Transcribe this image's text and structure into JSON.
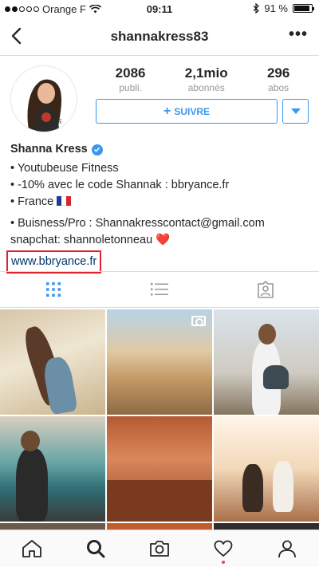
{
  "status_bar": {
    "carrier": "Orange F",
    "time": "09:11",
    "battery": "91 %",
    "battery_level": 0.91
  },
  "nav": {
    "username": "shannakress83"
  },
  "profile": {
    "stats": [
      {
        "value": "2086",
        "label": "publi."
      },
      {
        "value": "2,1mio",
        "label": "abonnés"
      },
      {
        "value": "296",
        "label": "abos"
      }
    ],
    "follow_label": "SUIVRE",
    "name": "Shanna Kress",
    "bio_lines": [
      "• Youtubeuse Fitness",
      "• -10% avec le code Shannak : bbryance.fr",
      "• France",
      "• Buisness/Pro : Shannakresscontact@gmail.com",
      "snapchat: shannoletonneau ❤️"
    ],
    "website": "www.bbryance.fr"
  },
  "icons": {
    "back": "chevron-left-icon",
    "more": "more-icon",
    "grid": "grid-view-icon",
    "list": "list-view-icon",
    "tagged": "tagged-photos-icon",
    "home": "home-icon",
    "search": "search-icon",
    "camera": "camera-icon",
    "activity": "heart-icon",
    "profile": "profile-icon"
  },
  "colors": {
    "accent": "#3897f0",
    "link_highlight": "#e0242d",
    "notification": "#ed4956"
  }
}
